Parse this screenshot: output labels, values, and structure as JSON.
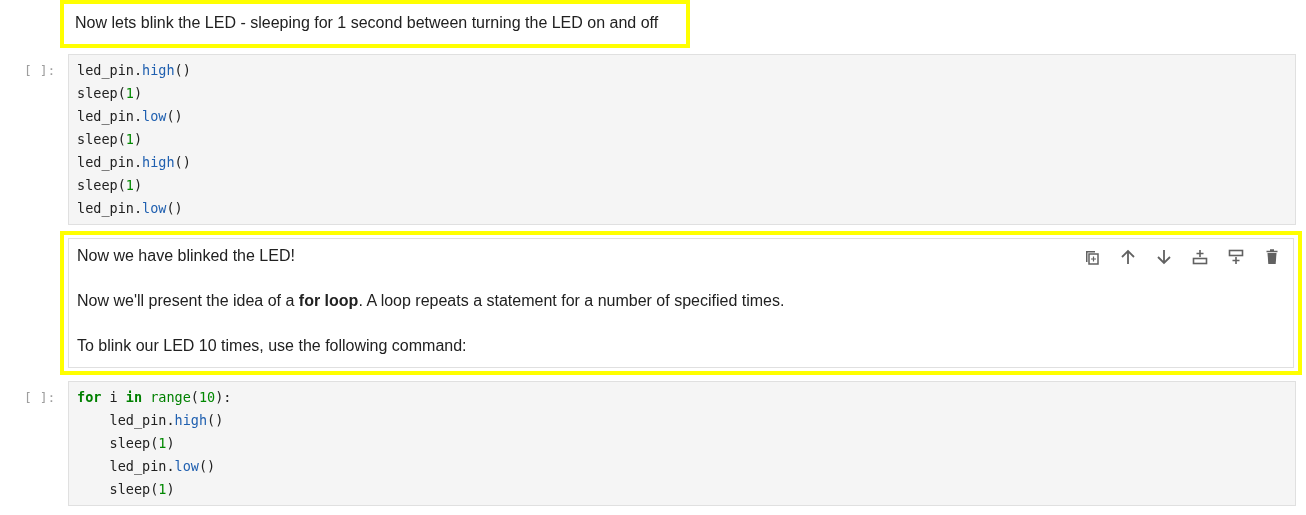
{
  "cells": [
    {
      "kind": "markdown",
      "selected": false,
      "highlighted": true,
      "paragraphs": [
        "Now lets blink the LED - sleeping for 1 second between turning the LED on and off"
      ]
    },
    {
      "kind": "code",
      "prompt": "[ ]:",
      "lines": [
        [
          {
            "text": "led_pin.",
            "kind": "plain"
          },
          {
            "text": "high",
            "kind": "attr"
          },
          {
            "text": "()",
            "kind": "plain"
          }
        ],
        [
          {
            "text": "sleep(",
            "kind": "plain"
          },
          {
            "text": "1",
            "kind": "number"
          },
          {
            "text": ")",
            "kind": "plain"
          }
        ],
        [
          {
            "text": "led_pin.",
            "kind": "plain"
          },
          {
            "text": "low",
            "kind": "attr"
          },
          {
            "text": "()",
            "kind": "plain"
          }
        ],
        [
          {
            "text": "sleep(",
            "kind": "plain"
          },
          {
            "text": "1",
            "kind": "number"
          },
          {
            "text": ")",
            "kind": "plain"
          }
        ],
        [
          {
            "text": "led_pin.",
            "kind": "plain"
          },
          {
            "text": "high",
            "kind": "attr"
          },
          {
            "text": "()",
            "kind": "plain"
          }
        ],
        [
          {
            "text": "sleep(",
            "kind": "plain"
          },
          {
            "text": "1",
            "kind": "number"
          },
          {
            "text": ")",
            "kind": "plain"
          }
        ],
        [
          {
            "text": "led_pin.",
            "kind": "plain"
          },
          {
            "text": "low",
            "kind": "attr"
          },
          {
            "text": "()",
            "kind": "plain"
          }
        ]
      ]
    },
    {
      "kind": "markdown",
      "selected": true,
      "highlighted": true,
      "paragraphs": [
        "Now we have blinked the LED!",
        "Now we'll present the idea of a **for loop**. A loop repeats a statement for a number of specified times.",
        "To blink our LED 10 times, use the following command:"
      ]
    },
    {
      "kind": "code",
      "prompt": "[ ]:",
      "lines": [
        [
          {
            "text": "for",
            "kind": "keyword"
          },
          {
            "text": " i ",
            "kind": "plain"
          },
          {
            "text": "in",
            "kind": "keyword"
          },
          {
            "text": " range",
            "kind": "builtin"
          },
          {
            "text": "(",
            "kind": "plain"
          },
          {
            "text": "10",
            "kind": "number"
          },
          {
            "text": "):",
            "kind": "plain"
          }
        ],
        [
          {
            "text": "    led_pin.",
            "kind": "plain"
          },
          {
            "text": "high",
            "kind": "attr"
          },
          {
            "text": "()",
            "kind": "plain"
          }
        ],
        [
          {
            "text": "    sleep(",
            "kind": "plain"
          },
          {
            "text": "1",
            "kind": "number"
          },
          {
            "text": ")",
            "kind": "plain"
          }
        ],
        [
          {
            "text": "    led_pin.",
            "kind": "plain"
          },
          {
            "text": "low",
            "kind": "attr"
          },
          {
            "text": "()",
            "kind": "plain"
          }
        ],
        [
          {
            "text": "    sleep(",
            "kind": "plain"
          },
          {
            "text": "1",
            "kind": "number"
          },
          {
            "text": ")",
            "kind": "plain"
          }
        ]
      ]
    }
  ]
}
